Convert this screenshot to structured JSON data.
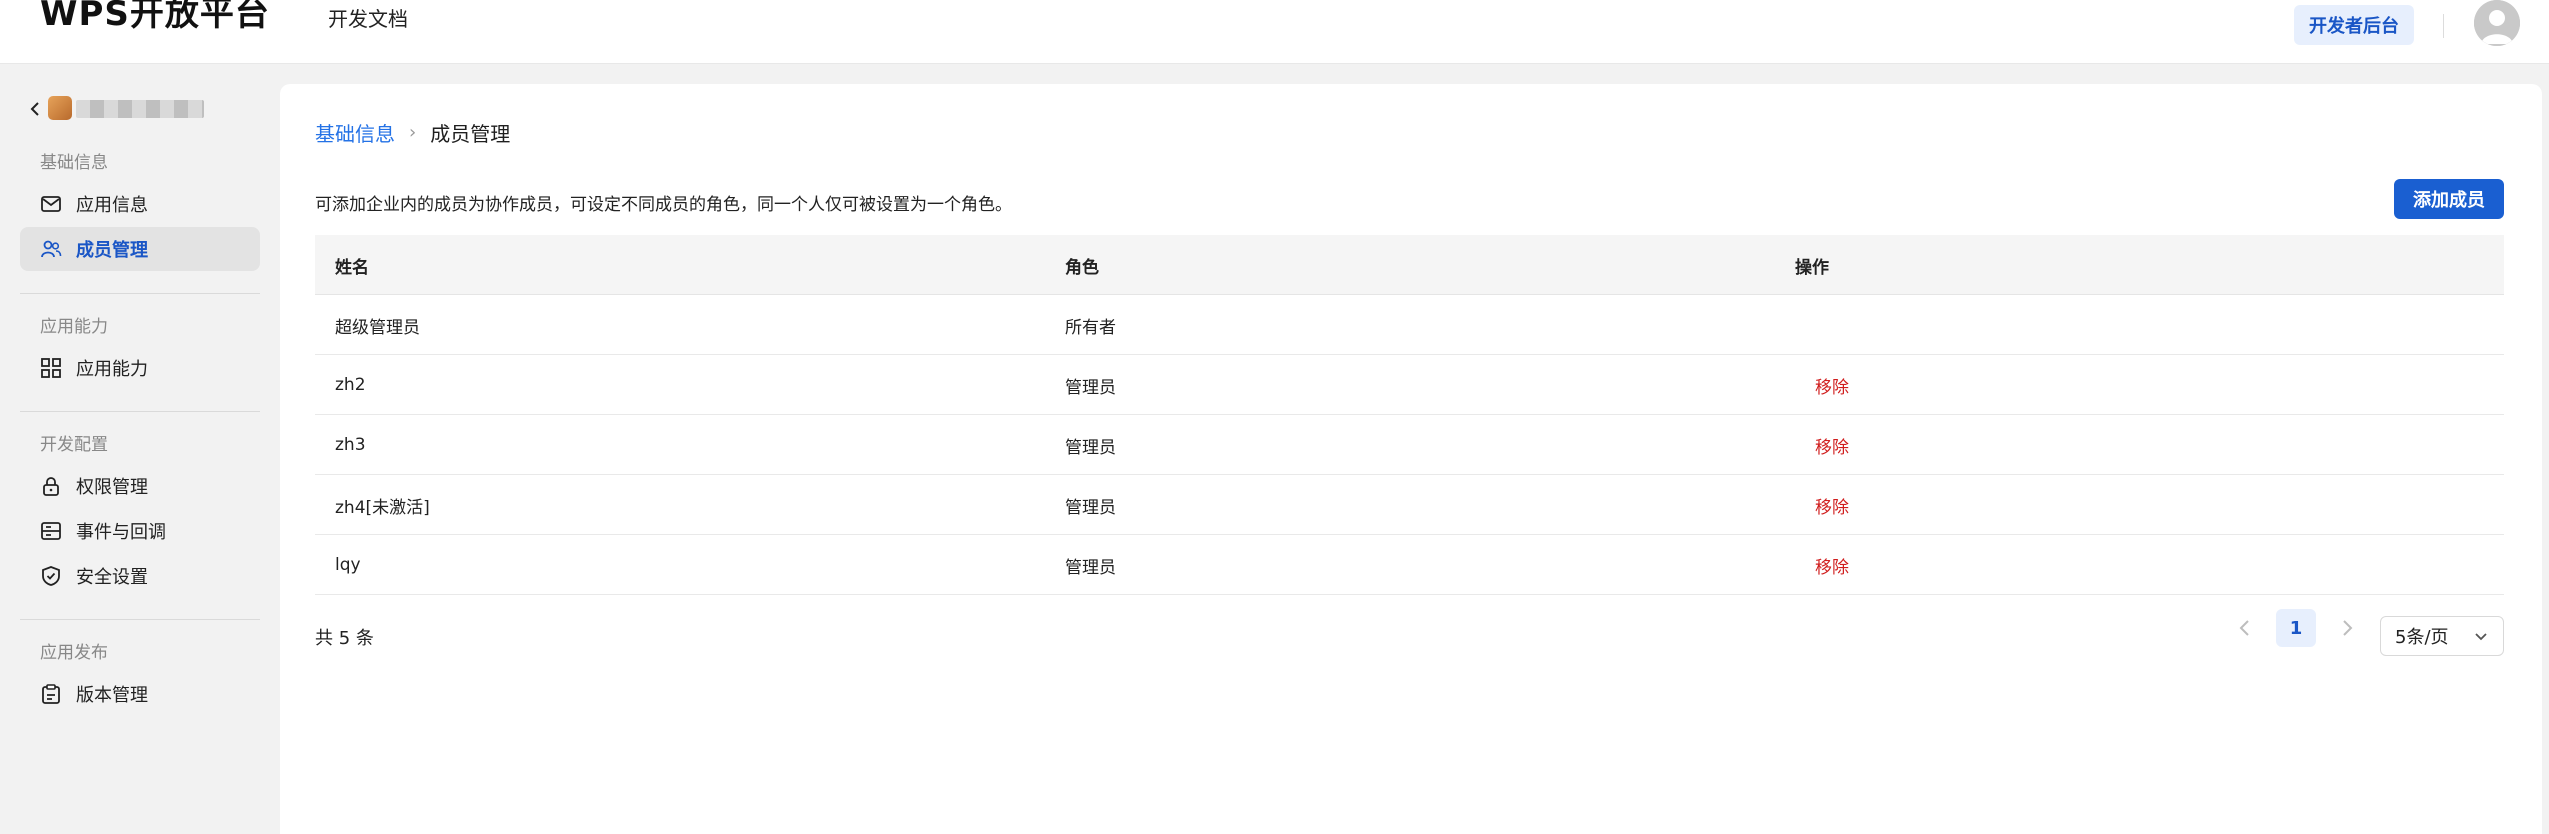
{
  "header": {
    "logo": "WPS开放平台",
    "nav_doc": "开发文档",
    "dev_console": "开发者后台"
  },
  "sidebar": {
    "sections": [
      {
        "title": "基础信息",
        "items": [
          {
            "label": "应用信息",
            "icon": "mail-icon"
          },
          {
            "label": "成员管理",
            "icon": "users-icon",
            "active": true
          }
        ]
      },
      {
        "title": "应用能力",
        "items": [
          {
            "label": "应用能力",
            "icon": "grid-icon"
          }
        ]
      },
      {
        "title": "开发配置",
        "items": [
          {
            "label": "权限管理",
            "icon": "lock-icon"
          },
          {
            "label": "事件与回调",
            "icon": "event-icon"
          },
          {
            "label": "安全设置",
            "icon": "shield-icon"
          }
        ]
      },
      {
        "title": "应用发布",
        "items": [
          {
            "label": "版本管理",
            "icon": "clipboard-icon"
          }
        ]
      }
    ]
  },
  "breadcrumb": {
    "parent": "基础信息",
    "current": "成员管理"
  },
  "main": {
    "description": "可添加企业内的成员为协作成员，可设定不同成员的角色，同一个人仅可被设置为一个角色。",
    "add_button": "添加成员"
  },
  "table": {
    "headers": [
      "姓名",
      "角色",
      "操作"
    ],
    "rows": [
      {
        "name": "超级管理员",
        "role": "所有者",
        "action": ""
      },
      {
        "name": "zh2",
        "role": "管理员",
        "action": "移除"
      },
      {
        "name": "zh3",
        "role": "管理员",
        "action": "移除"
      },
      {
        "name": "zh4[未激活]",
        "role": "管理员",
        "action": "移除"
      },
      {
        "name": "lqy",
        "role": "管理员",
        "action": "移除"
      }
    ]
  },
  "pagination": {
    "total": "共 5 条",
    "current_page": "1",
    "page_size": "5条/页"
  },
  "colors": {
    "accent": "#1a5fd1",
    "link": "#2472e6",
    "danger": "#d01d1d"
  }
}
